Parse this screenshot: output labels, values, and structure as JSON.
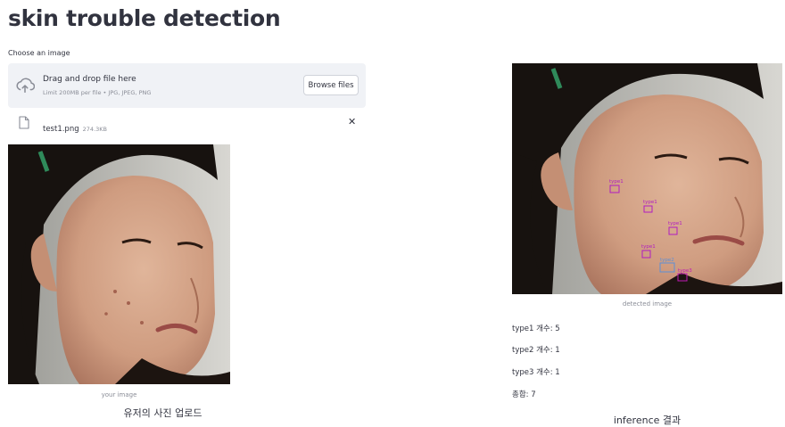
{
  "page": {
    "title": "skin trouble detection"
  },
  "uploader": {
    "label": "Choose an image",
    "drop_title": "Drag and drop file here",
    "drop_sub": "Limit 200MB per file • JPG, JPEG, PNG",
    "browse_label": "Browse files",
    "file": {
      "name": "test1.png",
      "size": "274.3KB"
    },
    "remove_glyph": "✕"
  },
  "left": {
    "caption": "your image",
    "subtitle": "유저의 사진 업로드"
  },
  "right": {
    "caption": "detected image",
    "subtitle": "inference 결과",
    "stats": [
      "type1 개수: 5",
      "type2 개수: 1",
      "type3 개수: 1",
      "총합: 7"
    ],
    "detections": [
      {
        "label": "type1"
      },
      {
        "label": "type1"
      },
      {
        "label": "type1"
      },
      {
        "label": "type1"
      },
      {
        "label": "type2"
      },
      {
        "label": "type3"
      }
    ]
  },
  "colors": {
    "text": "#31333f",
    "muted": "#8a8d97",
    "dropzone": "#f0f2f6",
    "type1": "#b01cc1",
    "type2": "#5b8fd6",
    "type3": "#c01ab4"
  },
  "icons": {
    "upload": "cloud-upload-icon",
    "file": "file-icon",
    "close": "close-icon"
  }
}
